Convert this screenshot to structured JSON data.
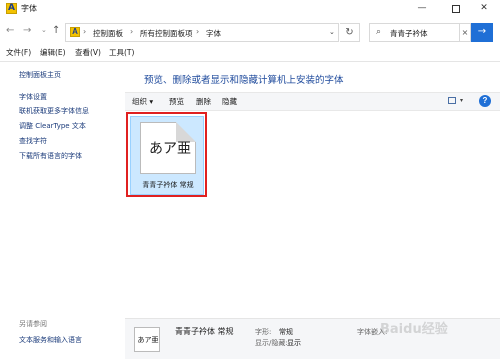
{
  "window": {
    "title": "字体",
    "icon_glyph": "A",
    "controls": {
      "minimize": "—",
      "close": "✕"
    }
  },
  "nav": {
    "back": "←",
    "forward": "→",
    "dropdown": "⌄",
    "up": "↑",
    "breadcrumbs": [
      "控制面板",
      "所有控制面板项",
      "字体"
    ],
    "refresh": "↻"
  },
  "search": {
    "value": "青青子衿体",
    "clear": "×",
    "go": "→"
  },
  "menu": {
    "items": [
      "文件(F)",
      "编辑(E)",
      "查看(V)",
      "工具(T)"
    ]
  },
  "left_pane": {
    "links": [
      "控制面板主页",
      "字体设置",
      "联机获取更多字体信息",
      "调整 ClearType 文本",
      "查找字符",
      "下载所有语言的字体"
    ],
    "see_also": "另请参阅",
    "see_also_link": "文本服务和输入语言"
  },
  "main": {
    "title": "预览、删除或者显示和隐藏计算机上安装的字体",
    "toolbar": {
      "organize": "组织 ▾",
      "preview": "预览",
      "delete": "删除",
      "hide": "隐藏",
      "view_drop": "▾",
      "help": "?"
    },
    "font_item": {
      "sample": "あア亜",
      "label": "青青子衿体 常规"
    }
  },
  "details": {
    "thumb_sample": "あア亜",
    "name": "青青子衿体 常规",
    "style_label": "字形:",
    "style_value": "常规",
    "visibility_label": "显示/隐藏:",
    "visibility_value": "显示",
    "embed_label": "字体嵌入:"
  },
  "watermark": "Baidu经验",
  "colors": {
    "accent": "#1f6fd6",
    "selection_bg": "#cce8ff",
    "highlight_border": "#e02020",
    "link": "#1a3a7a",
    "title_blue": "#1e4a9c"
  }
}
